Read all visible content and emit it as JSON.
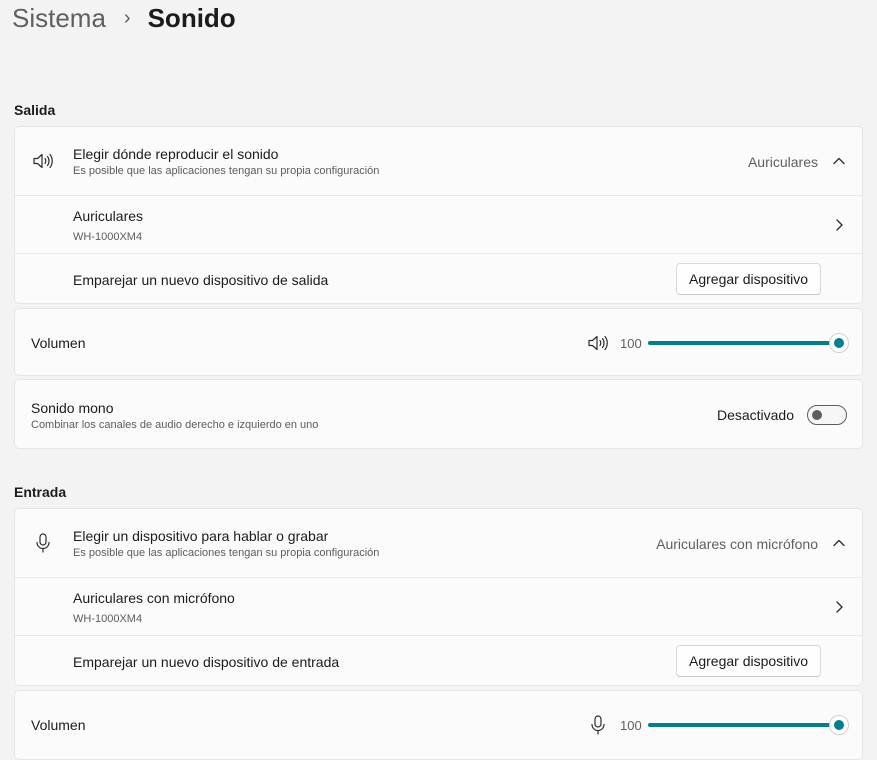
{
  "breadcrumb": {
    "parent": "Sistema",
    "separator": "›",
    "current": "Sonido"
  },
  "output": {
    "section_title": "Salida",
    "chooser": {
      "title": "Elegir dónde reproducir el sonido",
      "subtitle": "Es posible que las aplicaciones tengan su propia configuración",
      "selected": "Auriculares"
    },
    "device": {
      "name": "Auriculares",
      "model": "WH-1000XM4"
    },
    "pair": {
      "label": "Emparejar un nuevo dispositivo de salida",
      "button": "Agregar dispositivo"
    },
    "volume": {
      "label": "Volumen",
      "value": "100",
      "level": 1.0
    },
    "mono": {
      "title": "Sonido mono",
      "subtitle": "Combinar los canales de audio derecho e izquierdo en uno",
      "state": "Desactivado",
      "on": false
    }
  },
  "input": {
    "section_title": "Entrada",
    "chooser": {
      "title": "Elegir un dispositivo para hablar o grabar",
      "subtitle": "Es posible que las aplicaciones tengan su propia configuración",
      "selected": "Auriculares con micrófono"
    },
    "device": {
      "name": "Auriculares con micrófono",
      "model": "WH-1000XM4"
    },
    "pair": {
      "label": "Emparejar un nuevo dispositivo de entrada",
      "button": "Agregar dispositivo"
    },
    "volume": {
      "label": "Volumen",
      "value": "100",
      "level": 1.0
    }
  },
  "colors": {
    "accent": "#00808b",
    "background": "#f3f3f3",
    "card": "#fbfbfb"
  },
  "icons": [
    "speaker-icon",
    "microphone-icon",
    "chevron-up-icon",
    "chevron-right-icon",
    "chevron-right-breadcrumb-icon"
  ]
}
